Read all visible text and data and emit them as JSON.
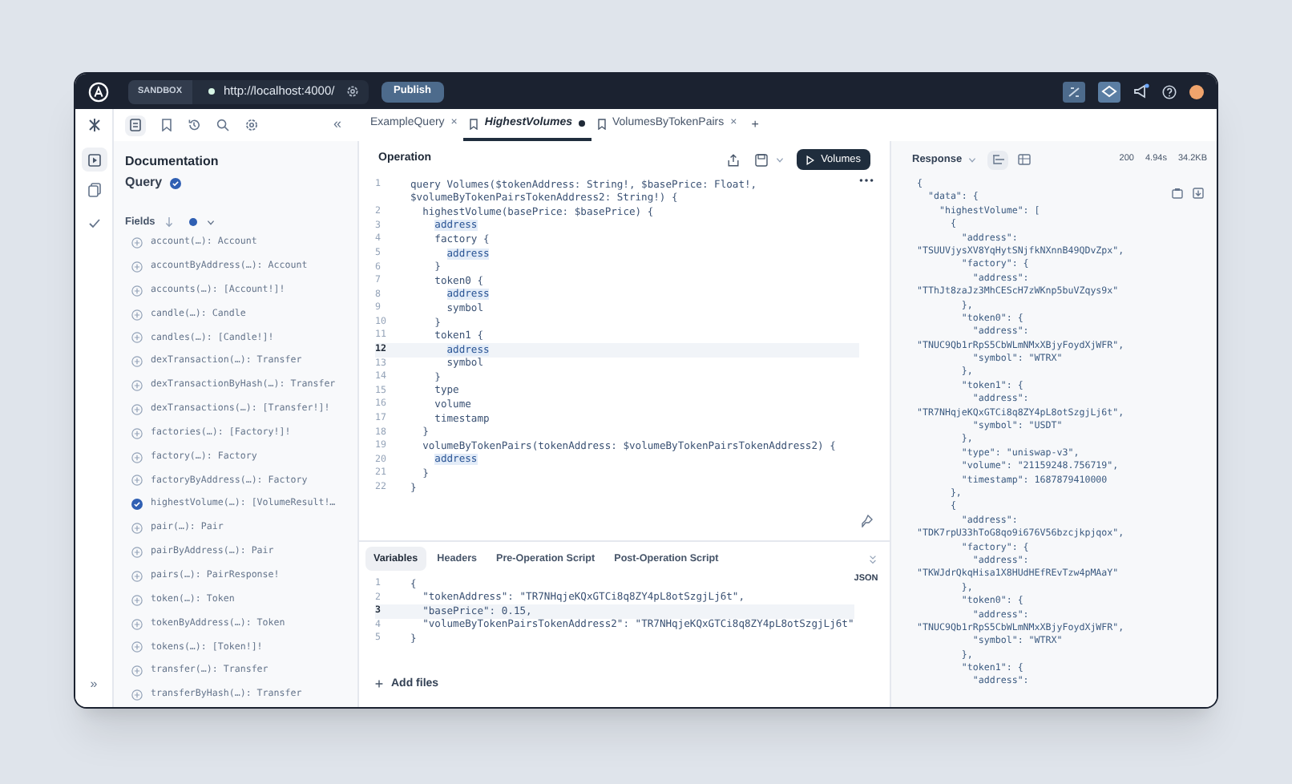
{
  "topbar": {
    "environment": "SANDBOX",
    "url": "http://localhost:4000/",
    "publish": "Publish"
  },
  "docs_toolbar": {
    "collapse": "«"
  },
  "tabs": [
    {
      "label": "ExampleQuery",
      "selected": false,
      "bookmarked": false,
      "modified": false,
      "close": "×"
    },
    {
      "label": "HighestVolumes",
      "selected": true,
      "bookmarked": true,
      "modified": true
    },
    {
      "label": "VolumesByTokenPairs",
      "selected": false,
      "bookmarked": true,
      "modified": false,
      "close": "×"
    }
  ],
  "new_tab": "+",
  "rail": {
    "expand": "»"
  },
  "docs": {
    "title": "Documentation",
    "root": "Query",
    "fields_label": "Fields",
    "fields": [
      {
        "text": "account(…): Account",
        "checked": false
      },
      {
        "text": "accountByAddress(…): Account",
        "checked": false
      },
      {
        "text": "accounts(…): [Account!]!",
        "checked": false
      },
      {
        "text": "candle(…): Candle",
        "checked": false
      },
      {
        "text": "candles(…): [Candle!]!",
        "checked": false
      },
      {
        "text": "dexTransaction(…): Transfer",
        "checked": false
      },
      {
        "text": "dexTransactionByHash(…): Transfer",
        "checked": false
      },
      {
        "text": "dexTransactions(…): [Transfer!]!",
        "checked": false
      },
      {
        "text": "factories(…): [Factory!]!",
        "checked": false
      },
      {
        "text": "factory(…): Factory",
        "checked": false
      },
      {
        "text": "factoryByAddress(…): Factory",
        "checked": false
      },
      {
        "text": "highestVolume(…): [VolumeResult!…",
        "checked": true
      },
      {
        "text": "pair(…): Pair",
        "checked": false
      },
      {
        "text": "pairByAddress(…): Pair",
        "checked": false
      },
      {
        "text": "pairs(…): PairResponse!",
        "checked": false
      },
      {
        "text": "token(…): Token",
        "checked": false
      },
      {
        "text": "tokenByAddress(…): Token",
        "checked": false
      },
      {
        "text": "tokens(…): [Token!]!",
        "checked": false
      },
      {
        "text": "transfer(…): Transfer",
        "checked": false
      },
      {
        "text": "transferByHash(…): Transfer",
        "checked": false
      }
    ]
  },
  "operation": {
    "title": "Operation",
    "run_button": "Volumes",
    "lines": [
      {
        "number": "1",
        "code": "query Volumes($tokenAddress: String!, $basePrice: Float!,",
        "highlight": false,
        "selected": false
      },
      {
        "code": "$volumeByTokenPairsTokenAddress2: String!) {",
        "highlight": false
      },
      {
        "number": "2",
        "code": "  highestVolume(basePrice: $basePrice) {",
        "highlight": false,
        "selected": false
      },
      {
        "number": "3",
        "code": "    address",
        "highlight": true,
        "selected": false
      },
      {
        "number": "4",
        "code": "    factory {",
        "highlight": false,
        "selected": false
      },
      {
        "number": "5",
        "code": "      address",
        "highlight": true,
        "selected": false
      },
      {
        "number": "6",
        "code": "    }",
        "highlight": false,
        "selected": false
      },
      {
        "number": "7",
        "code": "    token0 {",
        "highlight": false,
        "selected": false
      },
      {
        "number": "8",
        "code": "      address",
        "highlight": true,
        "selected": false
      },
      {
        "number": "9",
        "code": "      symbol",
        "highlight": false,
        "selected": false
      },
      {
        "number": "10",
        "code": "    }",
        "highlight": false,
        "selected": false
      },
      {
        "number": "11",
        "code": "    token1 {",
        "highlight": false,
        "selected": false
      },
      {
        "number": "12",
        "code": "      address",
        "highlight": true,
        "selected": true
      },
      {
        "number": "13",
        "code": "      symbol",
        "highlight": false,
        "selected": false
      },
      {
        "number": "14",
        "code": "    }",
        "highlight": false,
        "selected": false
      },
      {
        "number": "15",
        "code": "    type",
        "highlight": false,
        "selected": false
      },
      {
        "number": "16",
        "code": "    volume",
        "highlight": false,
        "selected": false
      },
      {
        "number": "17",
        "code": "    timestamp",
        "highlight": false,
        "selected": false
      },
      {
        "number": "18",
        "code": "  }",
        "highlight": false,
        "selected": false
      },
      {
        "number": "19",
        "code": "  volumeByTokenPairs(tokenAddress: $volumeByTokenPairsTokenAddress2) {",
        "highlight": false,
        "selected": false
      },
      {
        "number": "20",
        "code": "    address",
        "highlight": true,
        "selected": false
      },
      {
        "number": "21",
        "code": "  }",
        "highlight": false,
        "selected": false
      },
      {
        "number": "22",
        "code": "}",
        "highlight": false,
        "selected": false
      }
    ]
  },
  "variables": {
    "tabs": [
      {
        "label": "Variables",
        "selected": true
      },
      {
        "label": "Headers",
        "selected": false
      },
      {
        "label": "Pre-Operation Script",
        "selected": false
      },
      {
        "label": "Post-Operation Script",
        "selected": false
      }
    ],
    "format": "JSON",
    "lines": [
      {
        "number": "1",
        "code": "{",
        "selected": false
      },
      {
        "number": "2",
        "code": "  \"tokenAddress\": \"TR7NHqjeKQxGTCi8q8ZY4pL8otSzgjLj6t\",",
        "selected": false
      },
      {
        "number": "3",
        "code": "  \"basePrice\": 0.15,",
        "selected": true
      },
      {
        "number": "4",
        "code": "  \"volumeByTokenPairsTokenAddress2\": \"TR7NHqjeKQxGTCi8q8ZY4pL8otSzgjLj6t\"",
        "selected": false
      },
      {
        "number": "5",
        "code": "}",
        "selected": false
      }
    ],
    "add_files": "Add files"
  },
  "response": {
    "title": "Response",
    "status": "200",
    "time": "4.94s",
    "size": "34.2KB",
    "lines": [
      "{",
      "  \"data\": {",
      "    \"highestVolume\": [",
      "      {",
      "        \"address\":",
      "\"TSUUVjysXV8YqHytSNjfkNXnnB49QDvZpx\",",
      "        \"factory\": {",
      "          \"address\":",
      "\"TThJt8zaJz3MhCEScH7zWKnp5buVZqys9x\"",
      "        },",
      "        \"token0\": {",
      "          \"address\":",
      "\"TNUC9Qb1rRpS5CbWLmNMxXBjyFoydXjWFR\",",
      "          \"symbol\": \"WTRX\"",
      "        },",
      "        \"token1\": {",
      "          \"address\":",
      "\"TR7NHqjeKQxGTCi8q8ZY4pL8otSzgjLj6t\",",
      "          \"symbol\": \"USDT\"",
      "        },",
      "        \"type\": \"uniswap-v3\",",
      "        \"volume\": \"21159248.756719\",",
      "        \"timestamp\": 1687879410000",
      "      },",
      "      {",
      "        \"address\":",
      "\"TDK7rpU33hToG8qo9i676V56bzcjkpjqox\",",
      "        \"factory\": {",
      "          \"address\":",
      "\"TKWJdrQkqHisa1X8HUdHEfREvTzw4pMAaY\"",
      "        },",
      "        \"token0\": {",
      "          \"address\":",
      "\"TNUC9Qb1rRpS5CbWLmNMxXBjyFoydXjWFR\",",
      "          \"symbol\": \"WTRX\"",
      "        },",
      "        \"token1\": {",
      "          \"address\":"
    ]
  }
}
